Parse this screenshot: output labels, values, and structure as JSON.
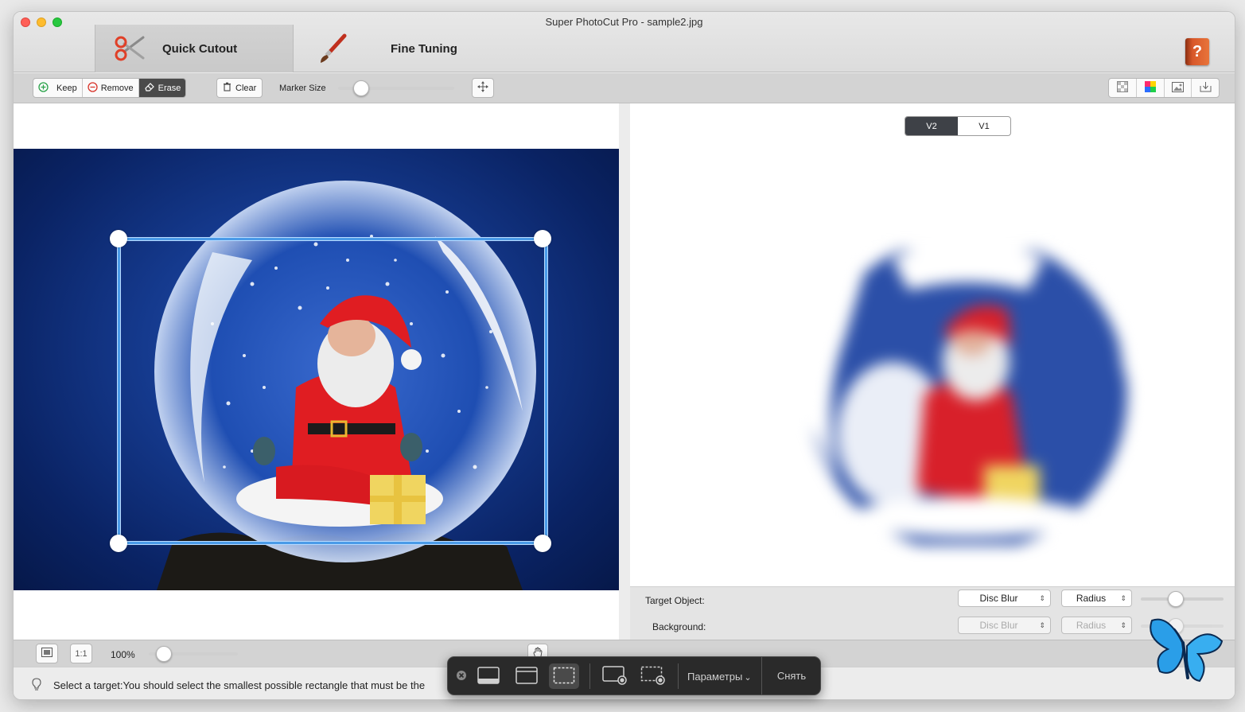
{
  "window": {
    "title": "Super PhotoCut Pro - sample2.jpg"
  },
  "mode_tabs": [
    {
      "label": "Quick Cutout",
      "active": true
    },
    {
      "label": "Fine Tuning",
      "active": false
    }
  ],
  "help": {
    "glyph": "?"
  },
  "toolbar": {
    "marker_buttons": [
      {
        "label": "Keep",
        "icon": "plus-circle-icon"
      },
      {
        "label": "Remove",
        "icon": "minus-circle-icon"
      },
      {
        "label": "Erase",
        "icon": "eraser-icon",
        "selected": true
      }
    ],
    "clear_label": "Clear",
    "marker_size_label": "Marker Size",
    "marker_size_value": 0.2
  },
  "view_toggle": {
    "options": [
      "V2",
      "V1"
    ],
    "selected": "V2"
  },
  "blur_settings": {
    "target_label": "Target Object:",
    "background_label": "Background:",
    "target_blur_type": "Disc Blur",
    "target_param": "Radius",
    "target_amount": 0.42,
    "background_blur_type": "Disc Blur",
    "background_param": "Radius",
    "background_amount": 0.42
  },
  "bottom": {
    "one_to_one_label": "1:1",
    "zoom_label": "100%",
    "zoom_value": 0.17
  },
  "status": {
    "text": "Select a target:You should select the smallest possible rectangle that must be the"
  },
  "capture_bar": {
    "options_label": "Параметры",
    "options_chevron": "⌄",
    "capture_label": "Снять"
  },
  "colors": {
    "accent_blue": "#4a9be8",
    "selection_handle": "#ffffff",
    "dark_segment": "#4a4a4a",
    "help_book": "#d8582a"
  }
}
